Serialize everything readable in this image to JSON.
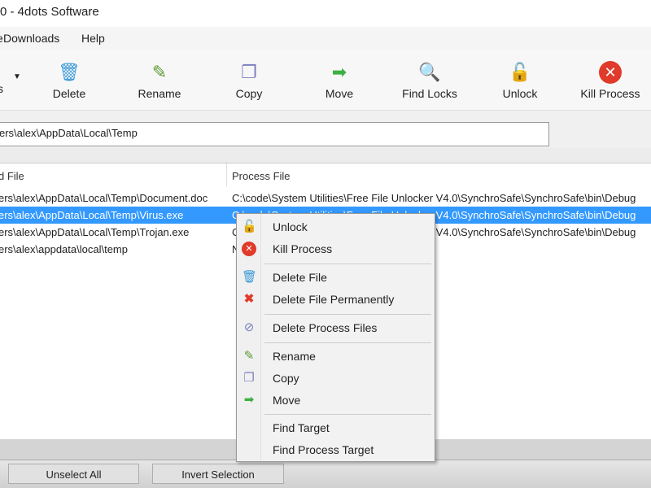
{
  "window": {
    "title": "0 - 4dots Software"
  },
  "menubar": {
    "items": [
      "Downloads",
      "Help"
    ],
    "partial_left": "e"
  },
  "toolbar": {
    "buttons": [
      {
        "label": "Delete",
        "icon": "recycle-bin-icon"
      },
      {
        "label": "Rename",
        "icon": "rename-pencil-icon"
      },
      {
        "label": "Copy",
        "icon": "copy-icon"
      },
      {
        "label": "Move",
        "icon": "green-arrow-icon"
      },
      {
        "label": "Find Locks",
        "icon": "magnifier-icon"
      },
      {
        "label": "Unlock",
        "icon": "open-padlock-icon"
      },
      {
        "label": "Kill Process",
        "icon": "red-x-icon"
      }
    ],
    "partial_left": "s"
  },
  "address": {
    "value": "ers\\alex\\AppData\\Local\\Temp"
  },
  "list": {
    "columns": [
      "d File",
      "Process File"
    ],
    "rows": [
      {
        "file": "ers\\alex\\AppData\\Local\\Temp\\Document.doc",
        "process": "C:\\code\\System Utilities\\Free File Unlocker V4.0\\SynchroSafe\\SynchroSafe\\bin\\Debug"
      },
      {
        "file": "ers\\alex\\AppData\\Local\\Temp\\Virus.exe",
        "process": "C:\\code\\System Utilities\\Free File Unlocker V4.0\\SynchroSafe\\SynchroSafe\\bin\\Debug",
        "selected": true
      },
      {
        "file": "ers\\alex\\AppData\\Local\\Temp\\Trojan.exe",
        "process": "C:\\code\\System Utilities\\Free File Unlocker V4.0\\SynchroSafe\\SynchroSafe\\bin\\Debug"
      },
      {
        "file": "ers\\alex\\appdata\\local\\temp",
        "process": "N"
      }
    ]
  },
  "context_menu": {
    "items": [
      {
        "label": "Unlock",
        "icon": "open-padlock-icon"
      },
      {
        "label": "Kill Process",
        "icon": "red-x-icon"
      },
      {
        "label": "Delete File",
        "icon": "recycle-bin-icon"
      },
      {
        "label": "Delete File Permanently",
        "icon": "red-cross-icon"
      },
      {
        "label": "Delete Process Files",
        "icon": "delete-process-icon"
      },
      {
        "label": "Rename",
        "icon": "rename-pencil-icon"
      },
      {
        "label": "Copy",
        "icon": "copy-icon"
      },
      {
        "label": "Move",
        "icon": "green-arrow-icon"
      },
      {
        "label": "Find Target",
        "icon": ""
      },
      {
        "label": "Find Process Target",
        "icon": ""
      }
    ]
  },
  "bottom": {
    "unselect_all": "Unselect All",
    "invert_selection": "Invert Selection"
  },
  "colors": {
    "selection": "#3399ff"
  }
}
